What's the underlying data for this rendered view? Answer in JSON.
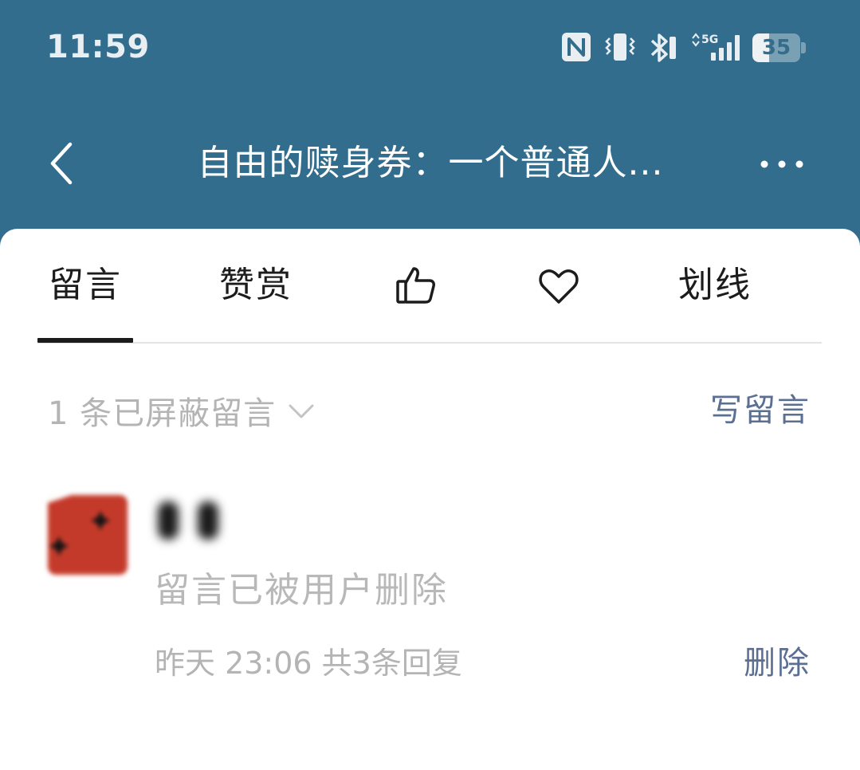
{
  "status_bar": {
    "time": "11:59",
    "network": "5G",
    "battery_level": "35",
    "battery_fraction": 0.35,
    "icons": [
      "nfc-icon",
      "vibrate-icon",
      "bluetooth-icon",
      "signal-5g-icon",
      "battery-icon"
    ]
  },
  "header": {
    "title": "自由的赎身券：一个普通人...",
    "back_icon": "chevron-left-icon",
    "more_icon": "more-horizontal-icon"
  },
  "tabs": [
    {
      "label": "留言",
      "selected": true
    },
    {
      "label": "赞赏",
      "selected": false
    },
    {
      "icon": "thumbs-up-icon",
      "selected": false
    },
    {
      "icon": "heart-icon",
      "selected": false
    },
    {
      "label": "划线",
      "selected": false
    }
  ],
  "filter": {
    "label": "1 条已屏蔽留言",
    "icon": "chevron-down-icon"
  },
  "write_comment": "写留言",
  "comment": {
    "body": "留言已被用户删除",
    "meta": "昨天 23:06 共3条回复",
    "delete_label": "删除"
  },
  "colors": {
    "header_bg": "#336d8d",
    "link": "#5b6f92",
    "muted": "#b4b4b4",
    "avatar": "#c43a2a"
  }
}
